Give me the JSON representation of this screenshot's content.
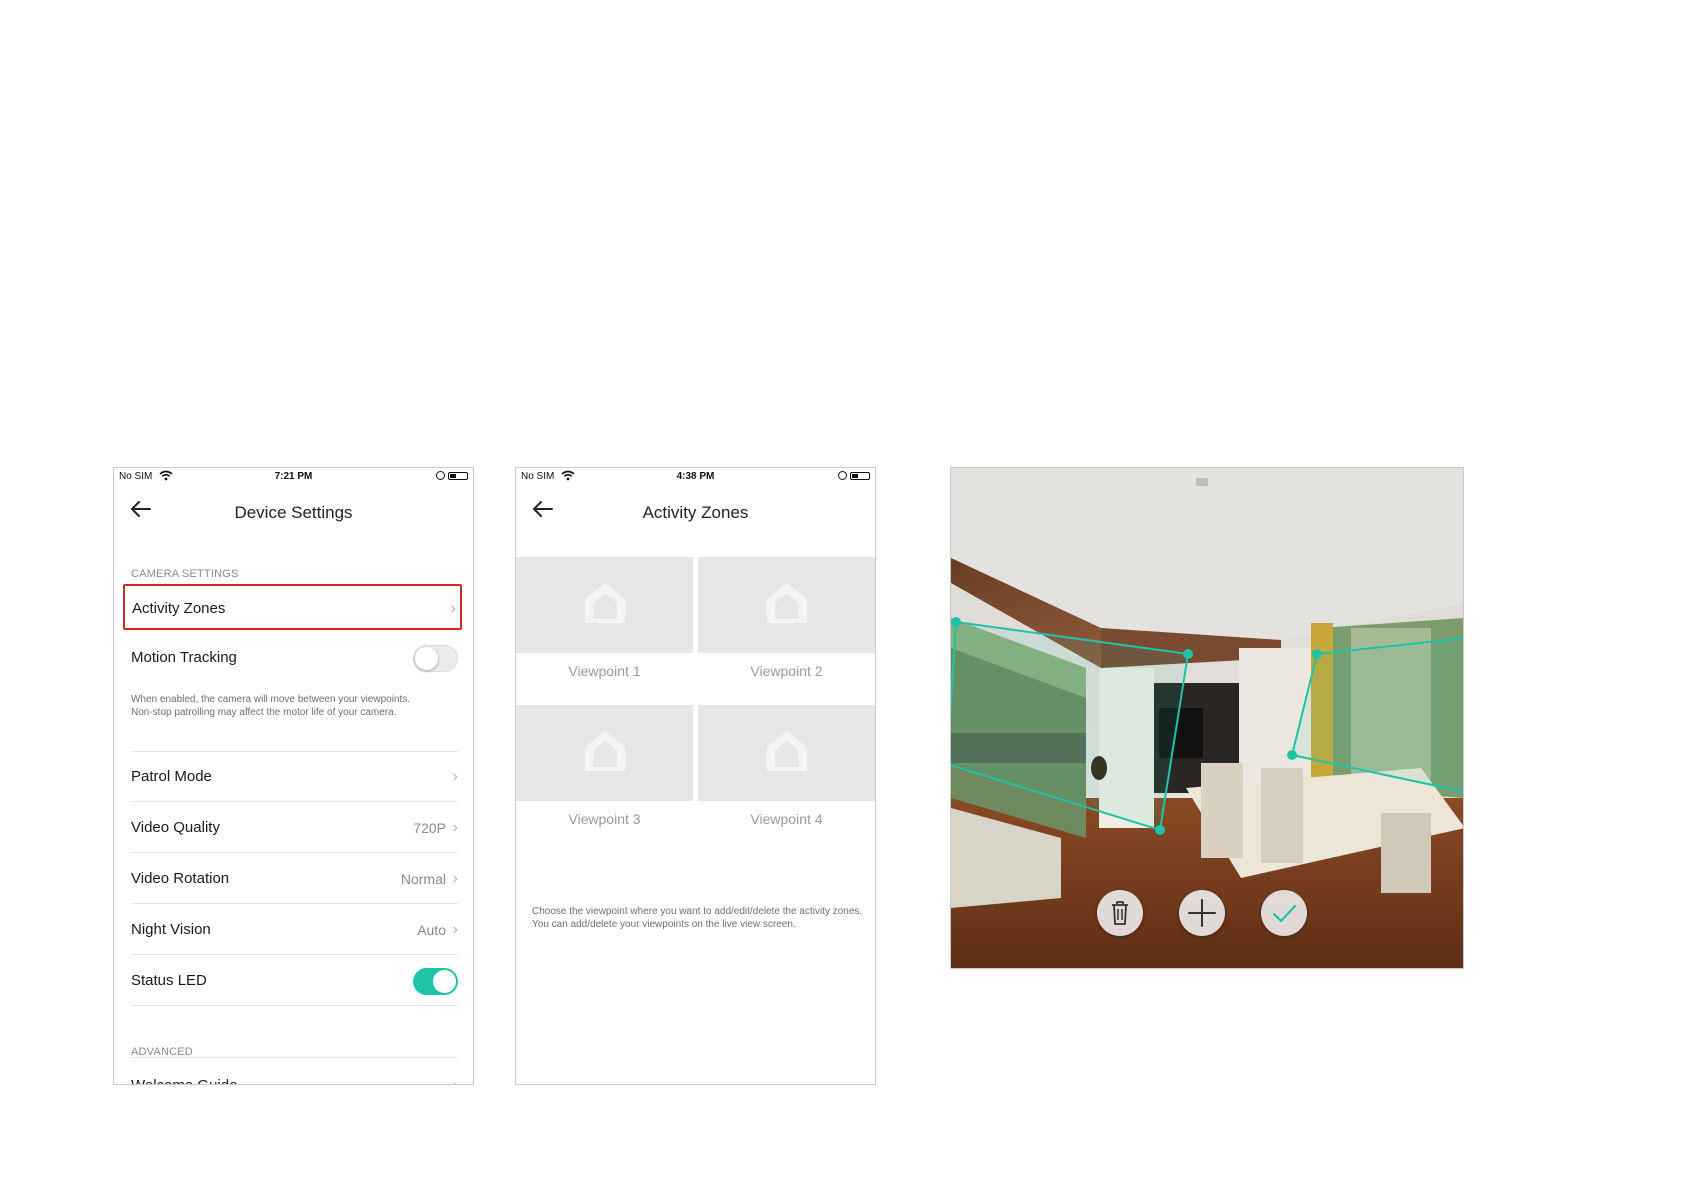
{
  "phone1": {
    "status": {
      "carrier": "No SIM",
      "time": "7:21 PM"
    },
    "title": "Device Settings",
    "camera_settings_header": "CAMERA SETTINGS",
    "rows": {
      "activity_zones": {
        "label": "Activity Zones"
      },
      "motion_tracking": {
        "label": "Motion Tracking",
        "enabled": false
      },
      "motion_tracking_desc": "When enabled, the camera will move between your viewpoints. Non-stop patrolling may affect the motor life of your camera.",
      "patrol_mode": {
        "label": "Patrol Mode"
      },
      "video_quality": {
        "label": "Video Quality",
        "value": "720P"
      },
      "video_rotation": {
        "label": "Video Rotation",
        "value": "Normal"
      },
      "night_vision": {
        "label": "Night Vision",
        "value": "Auto"
      },
      "status_led": {
        "label": "Status LED",
        "enabled": true
      }
    },
    "advanced_header": "ADVANCED",
    "welcome_guide": {
      "label": "Welcome Guide"
    }
  },
  "phone2": {
    "status": {
      "carrier": "No SIM",
      "time": "4:38 PM"
    },
    "title": "Activity Zones",
    "viewpoints": [
      "Viewpoint 1",
      "Viewpoint 2",
      "Viewpoint 3",
      "Viewpoint 4"
    ],
    "instructions": "Choose the viewpoint where you want to add/edit/delete the activity zones. You can add/delete your viewpoints on the live view screen."
  },
  "camera_view": {
    "buttons": [
      "trash-icon",
      "plus-icon",
      "check-icon"
    ],
    "zone_color": "#1ec3a8"
  },
  "colors": {
    "accent": "#1ec3a8",
    "highlight_border": "#cf2a2a"
  }
}
